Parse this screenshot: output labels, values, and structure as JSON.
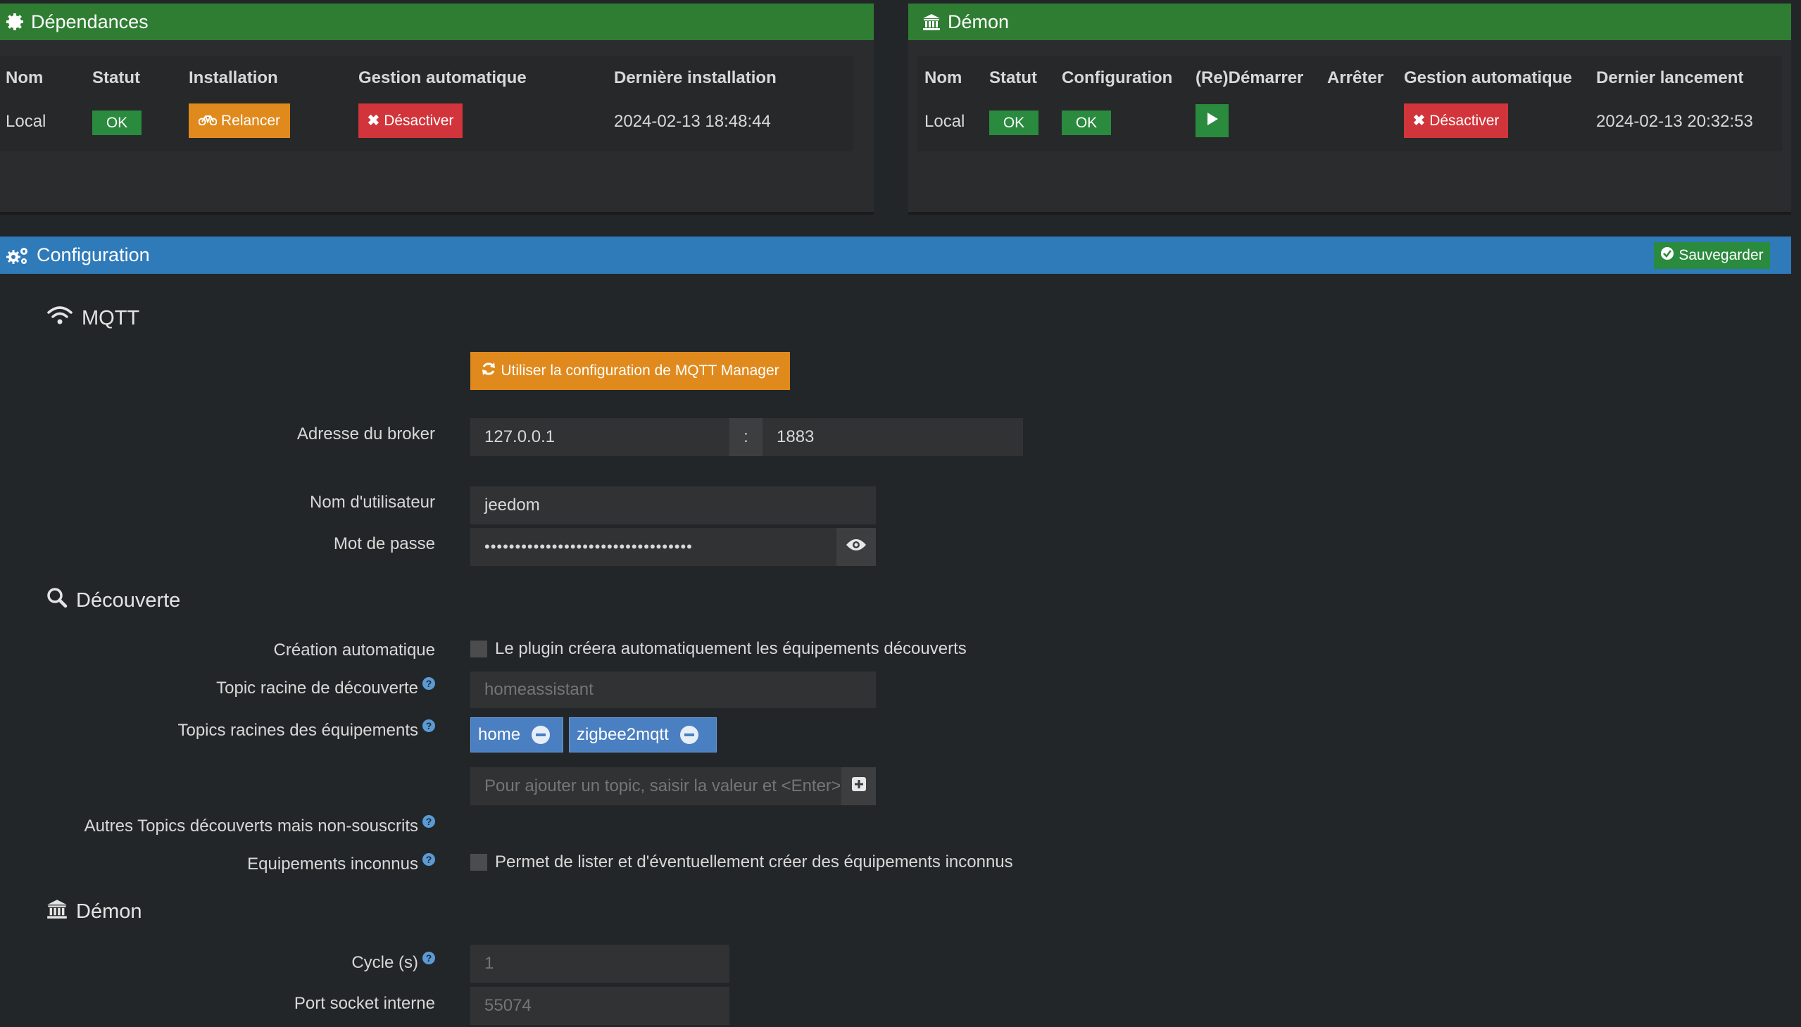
{
  "deps": {
    "title": "Dépendances",
    "headers": [
      "Nom",
      "Statut",
      "Installation",
      "Gestion automatique",
      "Dernière installation"
    ],
    "row": {
      "name": "Local",
      "status": "OK",
      "install_btn": "Relancer",
      "auto_btn": "Désactiver",
      "last": "2024-02-13 18:48:44"
    }
  },
  "daemon": {
    "title": "Démon",
    "headers": [
      "Nom",
      "Statut",
      "Configuration",
      "(Re)Démarrer",
      "Arrêter",
      "Gestion automatique",
      "Dernier lancement"
    ],
    "row": {
      "name": "Local",
      "status": "OK",
      "config": "OK",
      "auto_btn": "Désactiver",
      "last": "2024-02-13 20:32:53"
    }
  },
  "config": {
    "title": "Configuration",
    "save_btn": "Sauvegarder",
    "mqtt": {
      "title": "MQTT",
      "use_manager_btn": "Utiliser la configuration de MQTT Manager",
      "broker_label": "Adresse du broker",
      "broker_host": "127.0.0.1",
      "broker_sep": ":",
      "broker_port": "1883",
      "user_label": "Nom d'utilisateur",
      "user_value": "jeedom",
      "password_label": "Mot de passe",
      "password_value": "••••••••••••••••••••••••••••••••••"
    },
    "discovery": {
      "title": "Découverte",
      "auto_label": "Création automatique",
      "auto_text": "Le plugin créera automatiquement les équipements découverts",
      "root_label": "Topic racine de découverte",
      "root_placeholder": "homeassistant",
      "roots_label": "Topics racines des équipements",
      "tags": [
        "home",
        "zigbee2mqtt"
      ],
      "add_placeholder": "Pour ajouter un topic, saisir la valeur et <Enter>",
      "others_label": "Autres Topics découverts mais non-souscrits",
      "unknown_label": "Equipements inconnus",
      "unknown_text": "Permet de lister et d'éventuellement créer des équipements inconnus"
    },
    "daemon_section": {
      "title": "Démon",
      "cycle_label": "Cycle (s)",
      "cycle_placeholder": "1",
      "port_label": "Port socket interne",
      "port_placeholder": "55074"
    }
  }
}
